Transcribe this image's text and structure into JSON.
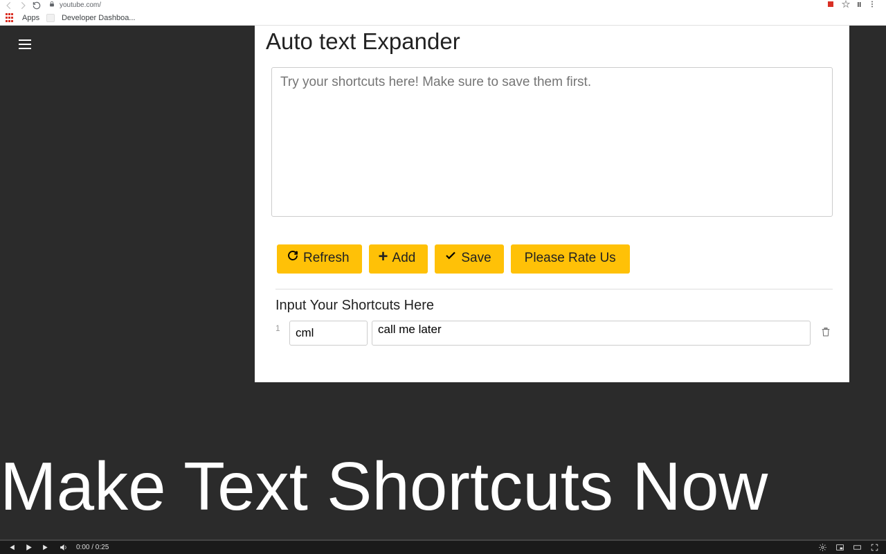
{
  "browser": {
    "url": "youtube.com/",
    "bookmarks": {
      "apps": "Apps",
      "devdash": "Developer Dashboa..."
    }
  },
  "ext": {
    "title": "Auto text Expander",
    "try_placeholder": "Try your shortcuts here! Make sure to save them first.",
    "buttons": {
      "refresh": "Refresh",
      "add": "Add",
      "save": "Save",
      "rate": "Please Rate Us"
    },
    "subhead": "Input Your Shortcuts Here",
    "row": {
      "num": "1",
      "short": "cml",
      "long": "call me later"
    }
  },
  "caption": "Make Text Shortcuts Now",
  "video": {
    "time": "0:00 / 0:25"
  }
}
